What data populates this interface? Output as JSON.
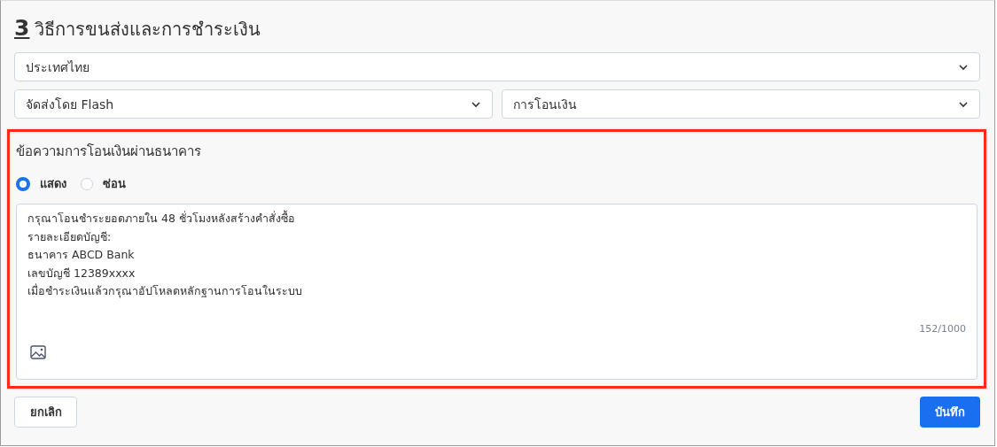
{
  "section": {
    "number": "3",
    "title": "วิธีการขนส่งและการชำระเงิน"
  },
  "country_select": {
    "value": "ประเทศไทย"
  },
  "shipping_select": {
    "value": "จัดส่งโดย Flash"
  },
  "payment_select": {
    "value": "การโอนเงิน"
  },
  "bank_message": {
    "label": "ข้อความการโอนเงินผ่านธนาคาร",
    "highlighted": true,
    "options": [
      {
        "label": "แสดง",
        "selected": true
      },
      {
        "label": "ซ่อน",
        "selected": false
      }
    ],
    "lines": [
      "กรุณาโอนชำระยอดภายใน 48 ชั่วโมงหลังสร้างคำสั่งซื้อ",
      "รายละเอียดบัญชี:",
      "ธนาคาร ABCD Bank",
      "เลขบัญชี 12389xxxx",
      "เมื่อชำระเงินแล้วกรุณาอัปโหลดหลักฐานการโอนในระบบ"
    ],
    "counter": "152/1000"
  },
  "buttons": {
    "cancel": "ยกเลิก",
    "save": "บันทึก"
  }
}
